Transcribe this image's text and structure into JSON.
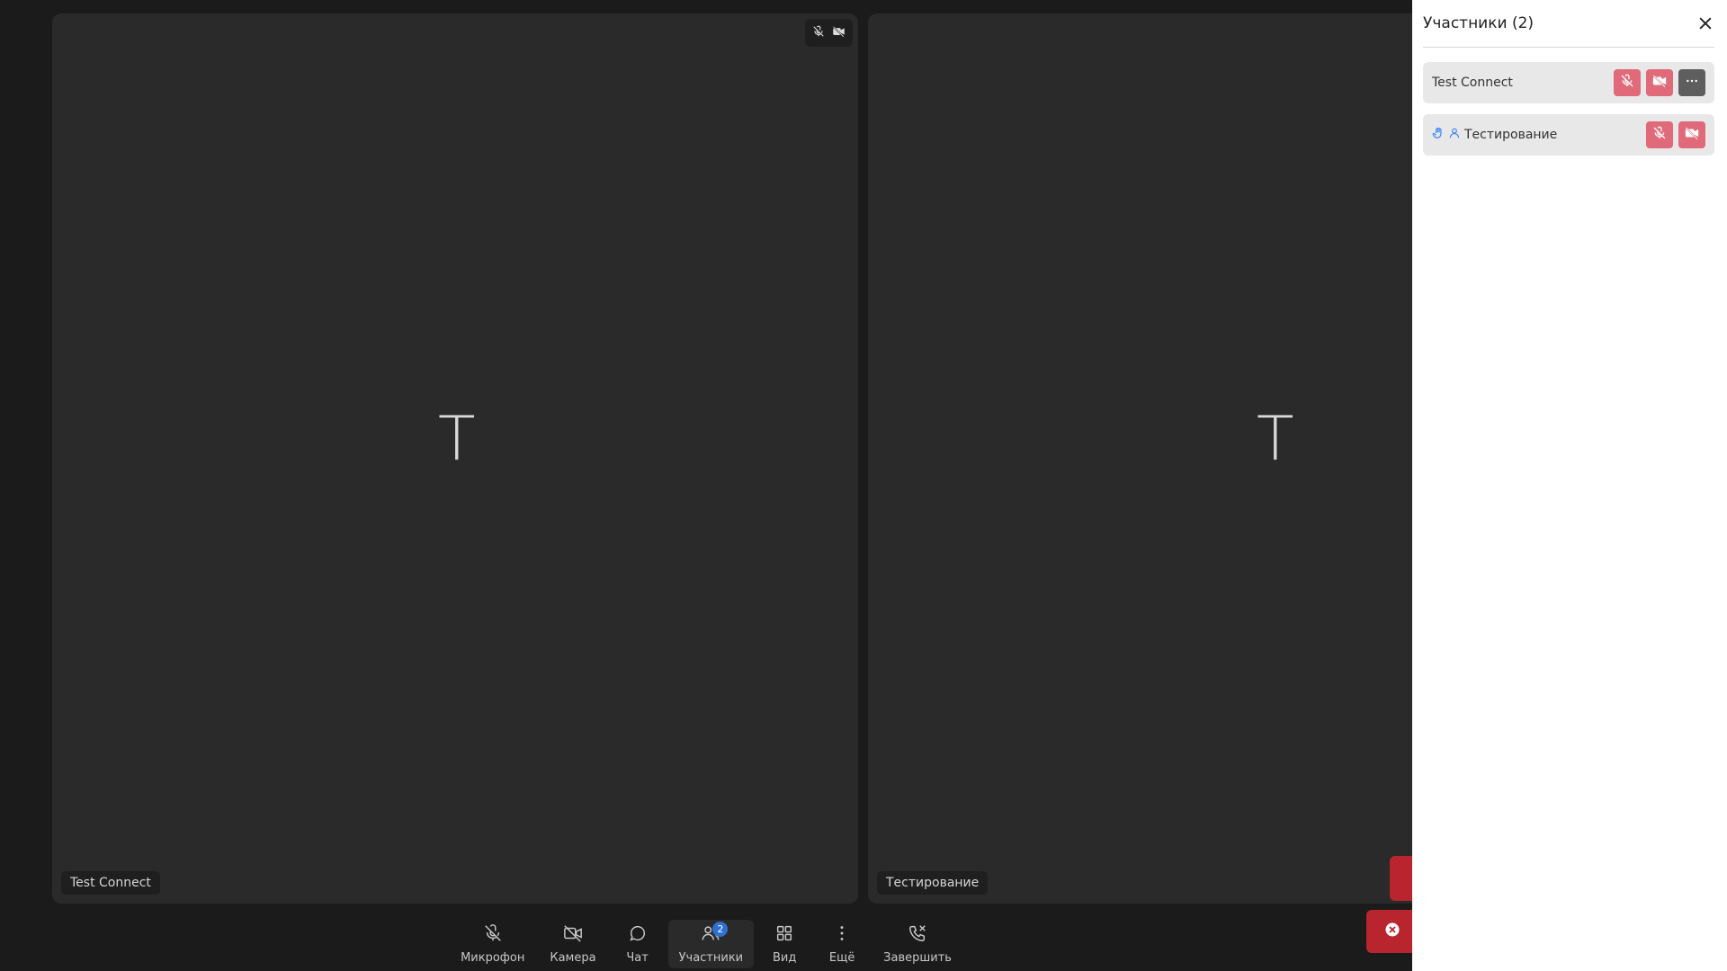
{
  "tiles": [
    {
      "letter": "T",
      "name": "Test Connect"
    },
    {
      "letter": "T",
      "name": "Тестирование"
    }
  ],
  "toolbar": {
    "mic_label": "Микрофон",
    "camera_label": "Камера",
    "chat_label": "Чат",
    "participants_label": "Участники",
    "participants_badge": "2",
    "view_label": "Вид",
    "more_label": "Ещё",
    "end_label": "Завершить"
  },
  "panel": {
    "title": "Участники (2)",
    "participants": [
      {
        "name": "Test Connect"
      },
      {
        "name": "Тестирование"
      }
    ]
  },
  "colors": {
    "muted_red": "#e06a7a",
    "badge_blue": "#2f6fd1",
    "toast_red": "#b9252f",
    "hand_blue": "#3b82f6"
  }
}
